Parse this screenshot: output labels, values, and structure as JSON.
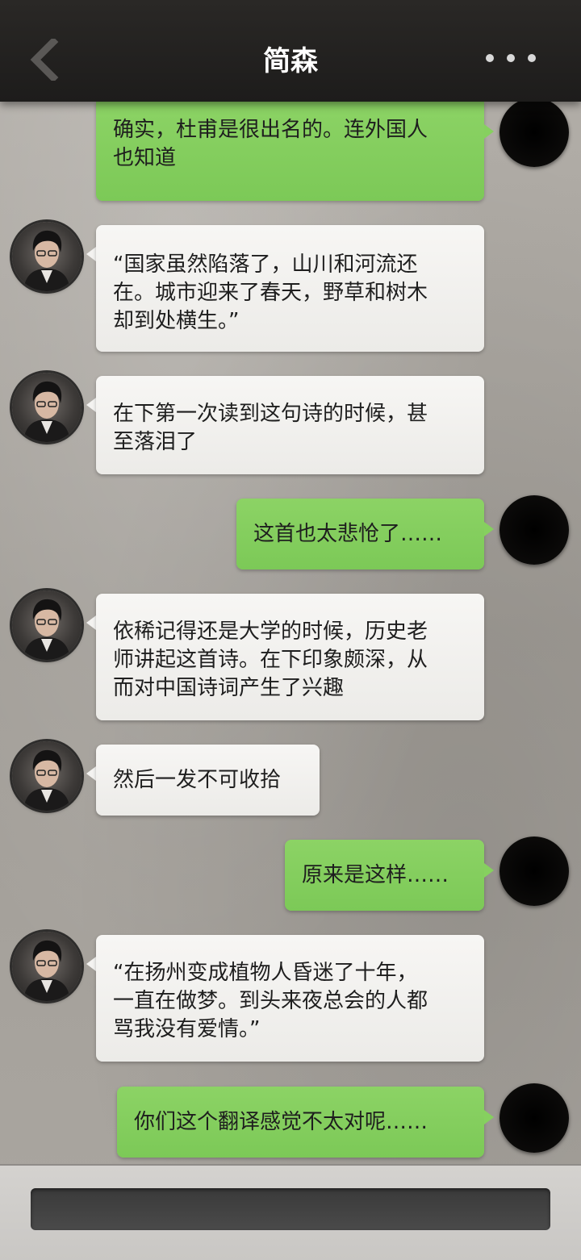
{
  "header": {
    "title": "简森",
    "back_icon": "chevron-left-icon",
    "more_icon": "more-dots-icon"
  },
  "messages": [
    {
      "sender": "me",
      "lines": [
        "确实，杜甫是很出名的。连外国人",
        "也知道"
      ]
    },
    {
      "sender": "jansen",
      "lines": [
        "“国家虽然陷落了，山川和河流还",
        "在。城市迎来了春天，野草和树木",
        "却到处横生。”"
      ]
    },
    {
      "sender": "jansen",
      "lines": [
        "在下第一次读到这句诗的时候，甚",
        "至落泪了"
      ]
    },
    {
      "sender": "me",
      "lines": [
        "这首也太悲怆了……"
      ]
    },
    {
      "sender": "jansen",
      "lines": [
        "依稀记得还是大学的时候，历史老",
        "师讲起这首诗。在下印象颇深，从",
        "而对中国诗词产生了兴趣"
      ]
    },
    {
      "sender": "jansen",
      "lines": [
        "然后一发不可收拾"
      ]
    },
    {
      "sender": "me",
      "lines": [
        "原来是这样……"
      ]
    },
    {
      "sender": "jansen",
      "lines": [
        "“在扬州变成植物人昏迷了十年，",
        "一直在做梦。到头来夜总会的人都",
        "骂我没有爱情。”"
      ]
    },
    {
      "sender": "me",
      "lines": [
        "你们这个翻译感觉不太对呢……"
      ]
    }
  ],
  "input": {
    "placeholder": ""
  },
  "colors": {
    "header_bg": "#1f1e1d",
    "incoming_bubble": "#f4f3f1",
    "outgoing_bubble": "#86d05f",
    "background": "#a7a39d"
  }
}
